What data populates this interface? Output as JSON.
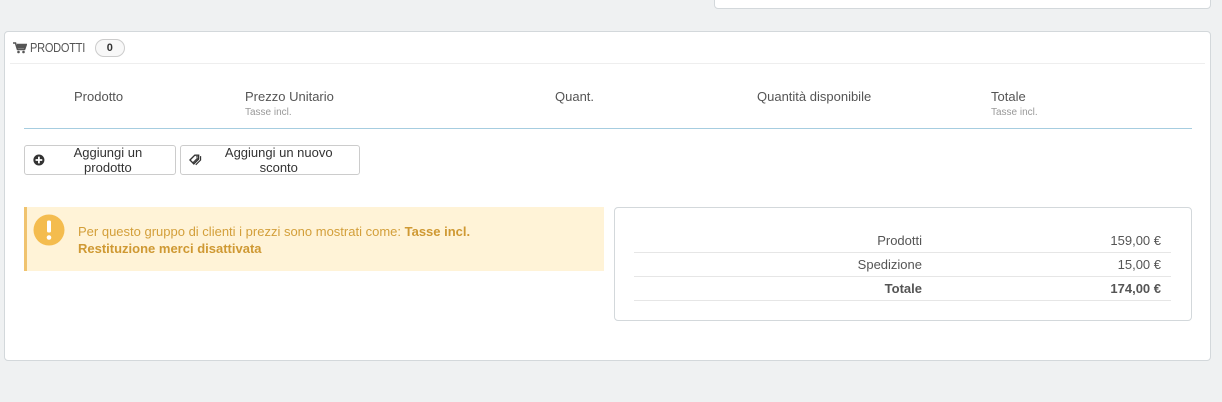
{
  "products_panel": {
    "title": "PRODOTTI",
    "count": "0",
    "columns": [
      {
        "label": "Prodotto",
        "sub": ""
      },
      {
        "label": "Prezzo Unitario",
        "sub": "Tasse incl."
      },
      {
        "label": "Quant.",
        "sub": ""
      },
      {
        "label": "Quantità disponibile",
        "sub": ""
      },
      {
        "label": "Totale",
        "sub": "Tasse incl."
      }
    ],
    "add_product_label": "Aggiungi un prodotto",
    "add_discount_label": "Aggiungi un nuovo sconto"
  },
  "alert": {
    "text": "Per questo gruppo di clienti i prezzi sono mostrati come: ",
    "strong": "Tasse incl.",
    "line2": "Restituzione merci disattivata"
  },
  "totals": {
    "rows": [
      {
        "label": "Prodotti",
        "value": "159,00 €"
      },
      {
        "label": "Spedizione",
        "value": "15,00 €"
      },
      {
        "label": "Totale",
        "value": "174,00 €"
      }
    ]
  },
  "colors": {
    "alert_bg": "#fff3d7",
    "alert_text": "#d39f3a",
    "table_line": "#a6cde0"
  },
  "icons": [
    "cart-icon",
    "plus-circle-icon",
    "tags-icon",
    "warning-icon"
  ]
}
